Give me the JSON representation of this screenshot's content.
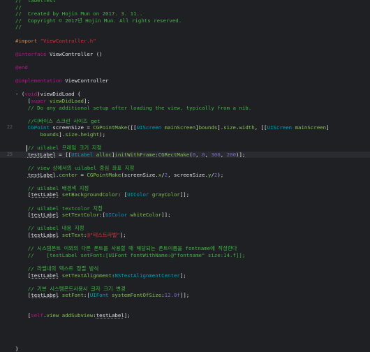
{
  "colors": {
    "background": "#1f2024",
    "current_line": "#2a2b30",
    "comment": "#41b645",
    "keyword": "#b21889",
    "preprocessor": "#c77c48",
    "string": "#db2c38",
    "type": "#00a0be",
    "method": "#83c057",
    "number": "#786dc4",
    "plain": "#dfe1e5",
    "line_number": "#5c5f66"
  },
  "current_line_number": "25",
  "lines": [
    {
      "num": "",
      "tokens": [
        {
          "t": "//  labelTest",
          "c": "comment"
        }
      ]
    },
    {
      "num": "",
      "tokens": [
        {
          "t": "//",
          "c": "comment"
        }
      ]
    },
    {
      "num": "",
      "tokens": [
        {
          "t": "//  Created by Hojin Mun on 2017. 3. 11..",
          "c": "comment"
        }
      ]
    },
    {
      "num": "",
      "tokens": [
        {
          "t": "//  Copyright © 2017년 Hojin Mun. All rights reserved.",
          "c": "comment"
        }
      ]
    },
    {
      "num": "",
      "tokens": [
        {
          "t": "//",
          "c": "comment"
        }
      ]
    },
    {
      "num": "",
      "tokens": []
    },
    {
      "num": "",
      "tokens": [
        {
          "t": "#import ",
          "c": "prep"
        },
        {
          "t": "\"ViewController.h\"",
          "c": "string"
        }
      ]
    },
    {
      "num": "",
      "tokens": []
    },
    {
      "num": "",
      "tokens": [
        {
          "t": "@interface",
          "c": "keyword"
        },
        {
          "t": " ViewController ()",
          "c": "plain"
        }
      ]
    },
    {
      "num": "",
      "tokens": []
    },
    {
      "num": "",
      "tokens": [
        {
          "t": "@end",
          "c": "keyword"
        }
      ]
    },
    {
      "num": "",
      "tokens": []
    },
    {
      "num": "",
      "tokens": [
        {
          "t": "@implementation",
          "c": "keyword"
        },
        {
          "t": " ViewController",
          "c": "plain"
        }
      ]
    },
    {
      "num": "",
      "tokens": []
    },
    {
      "num": "",
      "tokens": [
        {
          "t": "- (",
          "c": "plain"
        },
        {
          "t": "void",
          "c": "keyword"
        },
        {
          "t": ")viewDidLoad {",
          "c": "plain"
        }
      ]
    },
    {
      "num": "",
      "tokens": [
        {
          "t": "    [",
          "c": "plain"
        },
        {
          "t": "super",
          "c": "keyword"
        },
        {
          "t": " viewDidLoad",
          "c": "method"
        },
        {
          "t": "];",
          "c": "plain"
        }
      ]
    },
    {
      "num": "",
      "tokens": [
        {
          "t": "    // Do any additional setup after loading the view, typically from a nib.",
          "c": "comment"
        }
      ]
    },
    {
      "num": "",
      "tokens": []
    },
    {
      "num": "",
      "tokens": [
        {
          "t": "    //디바이스 스크린 사이즈 get",
          "c": "comment"
        }
      ]
    },
    {
      "num": "22",
      "tokens": [
        {
          "t": "    CGPoint",
          "c": "type"
        },
        {
          "t": " screenSize = ",
          "c": "plain"
        },
        {
          "t": "CGPointMake",
          "c": "method"
        },
        {
          "t": "([[",
          "c": "plain"
        },
        {
          "t": "UIScreen",
          "c": "type"
        },
        {
          "t": " ",
          "c": "plain"
        },
        {
          "t": "mainScreen",
          "c": "method"
        },
        {
          "t": "]",
          "c": "plain"
        },
        {
          "t": "bounds",
          "c": "method"
        },
        {
          "t": "].",
          "c": "plain"
        },
        {
          "t": "size",
          "c": "method"
        },
        {
          "t": ".",
          "c": "plain"
        },
        {
          "t": "width",
          "c": "method"
        },
        {
          "t": ", [[",
          "c": "plain"
        },
        {
          "t": "UIScreen",
          "c": "type"
        },
        {
          "t": " ",
          "c": "plain"
        },
        {
          "t": "mainScreen",
          "c": "method"
        },
        {
          "t": "]",
          "c": "plain"
        }
      ]
    },
    {
      "num": "",
      "tokens": [
        {
          "t": "        bounds",
          "c": "method"
        },
        {
          "t": "].",
          "c": "plain"
        },
        {
          "t": "size",
          "c": "method"
        },
        {
          "t": ".",
          "c": "plain"
        },
        {
          "t": "height",
          "c": "method"
        },
        {
          "t": ");",
          "c": "plain"
        }
      ]
    },
    {
      "num": "",
      "tokens": []
    },
    {
      "num": "",
      "tokens": [
        {
          "t": "    // uilabel 프레임 크기 지정",
          "c": "comment"
        }
      ]
    },
    {
      "num": "25",
      "current": true,
      "tokens": [
        {
          "t": "    ",
          "c": "plain"
        },
        {
          "t": "testLabel",
          "c": "var"
        },
        {
          "t": " = [[",
          "c": "plain"
        },
        {
          "t": "UILabel",
          "c": "type"
        },
        {
          "t": " ",
          "c": "plain"
        },
        {
          "t": "alloc",
          "c": "method"
        },
        {
          "t": "]",
          "c": "plain"
        },
        {
          "t": "initWithFrame",
          "c": "method"
        },
        {
          "t": ":",
          "c": "plain"
        },
        {
          "t": "CGRectMake",
          "c": "method"
        },
        {
          "t": "(",
          "c": "plain"
        },
        {
          "t": "0",
          "c": "number"
        },
        {
          "t": ", ",
          "c": "plain"
        },
        {
          "t": "0",
          "c": "number"
        },
        {
          "t": ", ",
          "c": "plain"
        },
        {
          "t": "300",
          "c": "number"
        },
        {
          "t": ", ",
          "c": "plain"
        },
        {
          "t": "200",
          "c": "number"
        },
        {
          "t": ")];",
          "c": "plain"
        }
      ]
    },
    {
      "num": "",
      "tokens": []
    },
    {
      "num": "",
      "tokens": [
        {
          "t": "    // view 상에서의 uilabel 중심 좌표 지정",
          "c": "comment"
        }
      ]
    },
    {
      "num": "",
      "tokens": [
        {
          "t": "    ",
          "c": "plain"
        },
        {
          "t": "testLabel",
          "c": "var"
        },
        {
          "t": ".",
          "c": "plain"
        },
        {
          "t": "center",
          "c": "method"
        },
        {
          "t": " = ",
          "c": "plain"
        },
        {
          "t": "CGPointMake",
          "c": "method"
        },
        {
          "t": "(screenSize.",
          "c": "plain"
        },
        {
          "t": "x",
          "c": "method"
        },
        {
          "t": "/",
          "c": "plain"
        },
        {
          "t": "2",
          "c": "number"
        },
        {
          "t": ", screenSize.",
          "c": "plain"
        },
        {
          "t": "y",
          "c": "method"
        },
        {
          "t": "/",
          "c": "plain"
        },
        {
          "t": "2",
          "c": "number"
        },
        {
          "t": ");",
          "c": "plain"
        }
      ]
    },
    {
      "num": "",
      "tokens": []
    },
    {
      "num": "",
      "tokens": [
        {
          "t": "    // uilabel 배경색 지정",
          "c": "comment"
        }
      ]
    },
    {
      "num": "",
      "tokens": [
        {
          "t": "    [",
          "c": "plain"
        },
        {
          "t": "testLabel",
          "c": "var"
        },
        {
          "t": " ",
          "c": "plain"
        },
        {
          "t": "setBackgroundColor",
          "c": "method"
        },
        {
          "t": ": [",
          "c": "plain"
        },
        {
          "t": "UIColor",
          "c": "type"
        },
        {
          "t": " ",
          "c": "plain"
        },
        {
          "t": "grayColor",
          "c": "method"
        },
        {
          "t": "]];",
          "c": "plain"
        }
      ]
    },
    {
      "num": "",
      "tokens": []
    },
    {
      "num": "",
      "tokens": [
        {
          "t": "    // uilabel textcolor 지정",
          "c": "comment"
        }
      ]
    },
    {
      "num": "",
      "tokens": [
        {
          "t": "    [",
          "c": "plain"
        },
        {
          "t": "testLabel",
          "c": "var"
        },
        {
          "t": " ",
          "c": "plain"
        },
        {
          "t": "setTextColor",
          "c": "method"
        },
        {
          "t": ":[",
          "c": "plain"
        },
        {
          "t": "UIColor",
          "c": "type"
        },
        {
          "t": " ",
          "c": "plain"
        },
        {
          "t": "whiteColor",
          "c": "method"
        },
        {
          "t": "]];",
          "c": "plain"
        }
      ]
    },
    {
      "num": "",
      "tokens": []
    },
    {
      "num": "",
      "tokens": [
        {
          "t": "    // uilabel 내용 지정",
          "c": "comment"
        }
      ]
    },
    {
      "num": "",
      "tokens": [
        {
          "t": "    [",
          "c": "plain"
        },
        {
          "t": "testLabel",
          "c": "var"
        },
        {
          "t": " ",
          "c": "plain"
        },
        {
          "t": "setText",
          "c": "method"
        },
        {
          "t": ":",
          "c": "plain"
        },
        {
          "t": "@\"테스트라벨\"",
          "c": "string"
        },
        {
          "t": "];",
          "c": "plain"
        }
      ]
    },
    {
      "num": "",
      "tokens": []
    },
    {
      "num": "",
      "tokens": [
        {
          "t": "    // 시스템폰트 이외의 다른 폰트를 사용할 때 해당되는 폰트이름을 fontname에 작성한다",
          "c": "comment"
        }
      ]
    },
    {
      "num": "",
      "tokens": [
        {
          "t": "    //    [testLabel setFont:[UIFont fontWithName:@\"fontname\" size:14.f]];",
          "c": "comment"
        }
      ]
    },
    {
      "num": "",
      "tokens": []
    },
    {
      "num": "",
      "tokens": [
        {
          "t": "    // 라벨내의 텍스트 정렬 방식",
          "c": "comment"
        }
      ]
    },
    {
      "num": "",
      "tokens": [
        {
          "t": "    [",
          "c": "plain"
        },
        {
          "t": "testLabel",
          "c": "var"
        },
        {
          "t": " ",
          "c": "plain"
        },
        {
          "t": "setTextAlignment",
          "c": "method"
        },
        {
          "t": ":",
          "c": "plain"
        },
        {
          "t": "NSTextAlignmentCenter",
          "c": "type"
        },
        {
          "t": "];",
          "c": "plain"
        }
      ]
    },
    {
      "num": "",
      "tokens": []
    },
    {
      "num": "",
      "tokens": [
        {
          "t": "    // 기본 시스템폰트사용시 글자 크기 변경",
          "c": "comment"
        }
      ]
    },
    {
      "num": "",
      "tokens": [
        {
          "t": "    [",
          "c": "plain"
        },
        {
          "t": "testLabel",
          "c": "var"
        },
        {
          "t": " ",
          "c": "plain"
        },
        {
          "t": "setFont",
          "c": "method"
        },
        {
          "t": ":[",
          "c": "plain"
        },
        {
          "t": "UIFont",
          "c": "type"
        },
        {
          "t": " ",
          "c": "plain"
        },
        {
          "t": "systemFontOfSize",
          "c": "method"
        },
        {
          "t": ":",
          "c": "plain"
        },
        {
          "t": "12.0f",
          "c": "number"
        },
        {
          "t": "]];",
          "c": "plain"
        }
      ]
    },
    {
      "num": "",
      "tokens": []
    },
    {
      "num": "",
      "tokens": []
    },
    {
      "num": "",
      "tokens": [
        {
          "t": "    [",
          "c": "plain"
        },
        {
          "t": "self",
          "c": "keyword"
        },
        {
          "t": ".",
          "c": "plain"
        },
        {
          "t": "view",
          "c": "method"
        },
        {
          "t": " ",
          "c": "plain"
        },
        {
          "t": "addSubview",
          "c": "method"
        },
        {
          "t": ":",
          "c": "plain"
        },
        {
          "t": "testLabel",
          "c": "var"
        },
        {
          "t": "];",
          "c": "plain"
        }
      ]
    },
    {
      "num": "",
      "tokens": []
    },
    {
      "num": "",
      "tokens": []
    },
    {
      "num": "",
      "tokens": []
    },
    {
      "num": "",
      "tokens": []
    },
    {
      "num": "",
      "tokens": [
        {
          "t": "}",
          "c": "plain"
        }
      ]
    }
  ]
}
